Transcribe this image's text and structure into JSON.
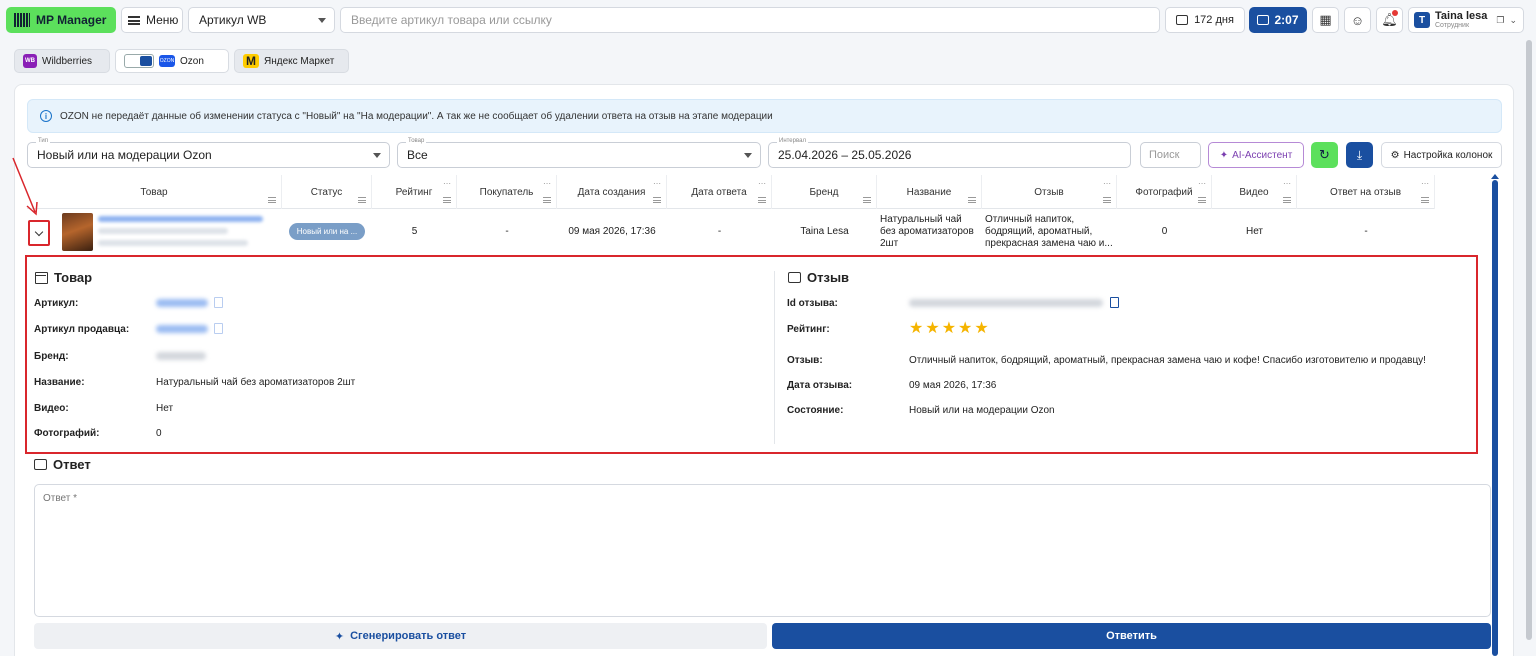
{
  "topbar": {
    "logo": "MP Manager",
    "menu": "Меню",
    "article_select": "Артикул WB",
    "search_placeholder": "Введите артикул товара или ссылку",
    "days": "172 дня",
    "timer": "2:07",
    "user_initial": "T",
    "user_name": "Taina lesa",
    "user_role": "Сотрудник"
  },
  "marketplaces": [
    {
      "label": "Wildberries",
      "logo": "WB"
    },
    {
      "label": "Ozon",
      "logo": "OZON"
    },
    {
      "label": "Яндекс Маркет",
      "logo": "M"
    }
  ],
  "info": "OZON не передаёт данные об изменении статуса с \"Новый\" на \"На модерации\". А так же не сообщает об удалении ответа на отзыв на этапе модерации",
  "filters": {
    "type_label": "Тип",
    "type_value": "Новый или на модерации Ozon",
    "goods_label": "Товар",
    "goods_value": "Все",
    "interval_label": "Интервал",
    "interval_value": "25.04.2026 – 25.05.2026",
    "search": "Поиск",
    "ai": "AI-Ассистент",
    "columns": "Настройка колонок"
  },
  "table": {
    "headers": [
      "Товар",
      "Статус",
      "Рейтинг",
      "Покупатель",
      "Дата создания",
      "Дата ответа",
      "Бренд",
      "Название",
      "Отзыв",
      "Фотографий",
      "Видео",
      "Ответ на отзыв"
    ],
    "row": {
      "status": "Новый или на ...",
      "rating": "5",
      "buyer": "-",
      "created": "09 мая 2026, 17:36",
      "answered": "-",
      "brand": "Taina Lesa",
      "name": "Натуральный чай без ароматизаторов 2шт",
      "review": "Отличный напиток, бодрящий, ароматный, прекрасная замена чаю и...",
      "photos": "0",
      "video": "Нет",
      "reply": "-"
    }
  },
  "product": {
    "title": "Товар",
    "article_label": "Артикул:",
    "seller_article_label": "Артикул продавца:",
    "brand_label": "Бренд:",
    "name_label": "Название:",
    "name_value": "Натуральный чай без ароматизаторов 2шт",
    "video_label": "Видео:",
    "video_value": "Нет",
    "photos_label": "Фотографий:",
    "photos_value": "0"
  },
  "review": {
    "title": "Отзыв",
    "id_label": "Id отзыва:",
    "rating_label": "Рейтинг:",
    "rating_value": 5,
    "text_label": "Отзыв:",
    "text_value": "Отличный напиток, бодрящий, ароматный, прекрасная замена чаю и кофе! Спасибо изготовителю и продавцу!",
    "date_label": "Дата отзыва:",
    "date_value": "09 мая 2026, 17:36",
    "state_label": "Состояние:",
    "state_value": "Новый или на модерации Ozon"
  },
  "reply": {
    "title": "Ответ",
    "placeholder": "Ответ *",
    "generate": "Сгенерировать ответ",
    "submit": "Ответить"
  },
  "colors": {
    "accent": "#1a4fa0",
    "green": "#5ce05c",
    "highlight": "#d9262c",
    "star": "#f5b400"
  }
}
